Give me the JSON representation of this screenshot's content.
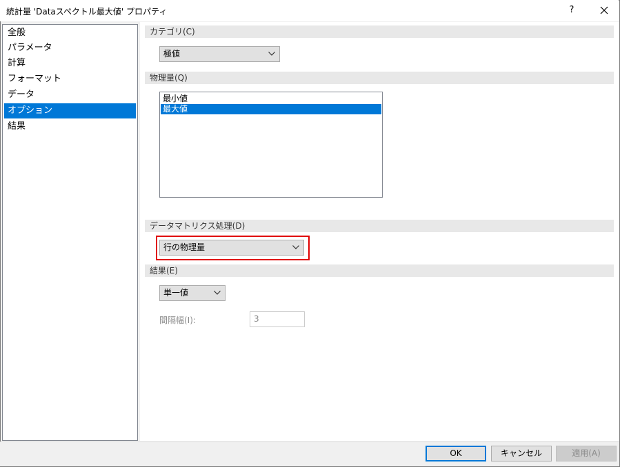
{
  "window": {
    "title": "統計量 'Dataスペクトル最大値' プロパティ",
    "help_label": "?",
    "close_label": "✕"
  },
  "sidebar": {
    "items": [
      {
        "label": "全般",
        "selected": false
      },
      {
        "label": "パラメータ",
        "selected": false
      },
      {
        "label": "計算",
        "selected": false
      },
      {
        "label": "フォーマット",
        "selected": false
      },
      {
        "label": "データ",
        "selected": false
      },
      {
        "label": "オプション",
        "selected": true
      },
      {
        "label": "結果",
        "selected": false
      }
    ]
  },
  "category": {
    "heading": "カテゴリ(C)",
    "selected": "極値"
  },
  "quantity": {
    "heading": "物理量(Q)",
    "items": [
      {
        "label": "最小値",
        "selected": false
      },
      {
        "label": "最大値",
        "selected": true
      }
    ]
  },
  "matrix": {
    "heading": "データマトリクス処理(D)",
    "selected": "行の物理量",
    "highlight_color": "#e00000"
  },
  "result": {
    "heading": "結果(E)",
    "selected": "単一値",
    "interval_label": "間隔幅(I):",
    "interval_value": "3"
  },
  "buttons": {
    "ok": "OK",
    "cancel": "キャンセル",
    "apply": "適用(A)"
  },
  "colors": {
    "accent": "#0078d7"
  }
}
